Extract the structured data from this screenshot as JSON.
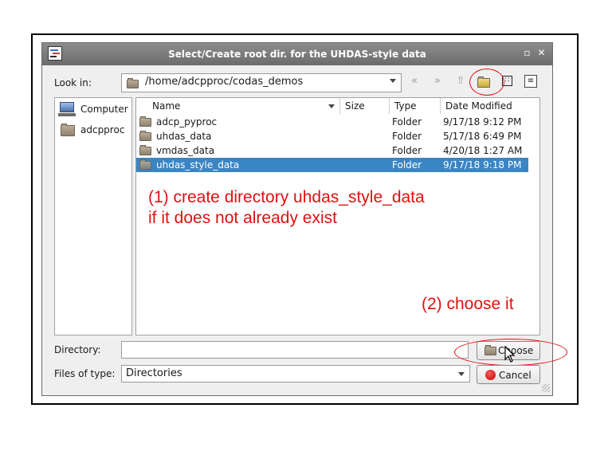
{
  "dialog": {
    "title": "Select/Create root dir. for the UHDAS-style data",
    "look_in_label": "Look in:",
    "look_in_path": "/home/adcpproc/codas_demos",
    "directory_label": "Directory:",
    "directory_value": "",
    "files_of_type_label": "Files of type:",
    "files_of_type_value": "Directories",
    "choose_label": "Choose",
    "cancel_label": "Cancel"
  },
  "window_controls": {
    "restore": "▫",
    "close": "✕"
  },
  "sidebar": {
    "items": [
      {
        "label": "Computer",
        "icon": "computer-icon"
      },
      {
        "label": "adcpproc",
        "icon": "folder-icon"
      }
    ]
  },
  "table": {
    "headers": {
      "name": "Name",
      "size": "Size",
      "type": "Type",
      "date": "Date Modified"
    },
    "rows": [
      {
        "name": "adcp_pyproc",
        "size": "",
        "type": "Folder",
        "date": "9/17/18 9:12 PM",
        "selected": false
      },
      {
        "name": "uhdas_data",
        "size": "",
        "type": "Folder",
        "date": "5/17/18 6:49 PM",
        "selected": false
      },
      {
        "name": "vmdas_data",
        "size": "",
        "type": "Folder",
        "date": "4/20/18 1:27 AM",
        "selected": false
      },
      {
        "name": "uhdas_style_data",
        "size": "",
        "type": "Folder",
        "date": "9/17/18 9:18 PM",
        "selected": true
      }
    ]
  },
  "annotations": {
    "step1_line1": "(1) create directory uhdas_style_data",
    "step1_line2": "if it does not already exist",
    "step2": "(2) choose it"
  },
  "colors": {
    "annotation": "#e01010",
    "selection": "#3a85c4",
    "titlebar": "#7a7a7a"
  }
}
